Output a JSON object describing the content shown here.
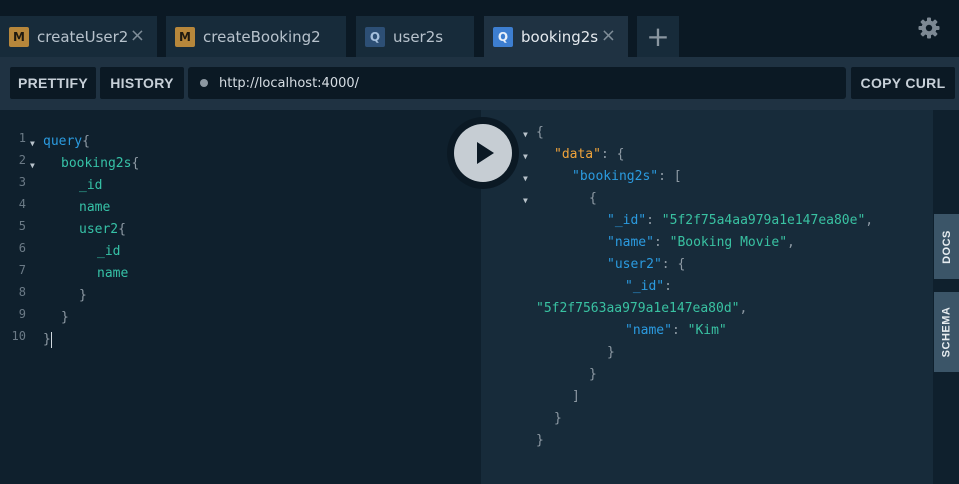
{
  "tabs": [
    {
      "badge": "M",
      "label": "createUser2",
      "close": "×"
    },
    {
      "badge": "M",
      "label": "createBooking2",
      "close": ""
    },
    {
      "badge": "Q",
      "label": "user2s",
      "close": ""
    },
    {
      "badge": "Q",
      "label": "booking2s",
      "close": "×"
    }
  ],
  "add_tab": "+",
  "toolbar": {
    "prettify": "PRETTIFY",
    "history": "HISTORY",
    "url": "http://localhost:4000/",
    "copy_curl": "COPY CURL"
  },
  "query": {
    "line_numbers": [
      "1",
      "2",
      "3",
      "4",
      "5",
      "6",
      "7",
      "8",
      "9",
      "10"
    ],
    "tokens": {
      "query_kw": "query",
      "brace_open": "{",
      "brace_close": "}",
      "booking2s": "booking2s",
      "id": "_id",
      "name": "name",
      "user2": "user2"
    }
  },
  "result": {
    "data_key": "\"data\"",
    "booking2s_key": "\"booking2s\"",
    "id_key": "\"_id\"",
    "name_key": "\"name\"",
    "user2_key": "\"user2\"",
    "booking_id": "\"5f2f75a4aa979a1e147ea80e\"",
    "booking_name": "\"Booking Movie\"",
    "user_id": "\"5f2f7563aa979a1e147ea80d\"",
    "user_name": "\"Kim\"",
    "colon_brace": ": {",
    "colon_bracket": ": [",
    "colon": ": ",
    "comma": ",",
    "colon_only": ":",
    "open_brace": "{",
    "close_brace": "}",
    "close_bracket": "]"
  },
  "side_tabs": {
    "docs": "DOCS",
    "schema": "SCHEMA"
  },
  "icons": {
    "settings": "gear-icon",
    "run": "play-icon"
  }
}
